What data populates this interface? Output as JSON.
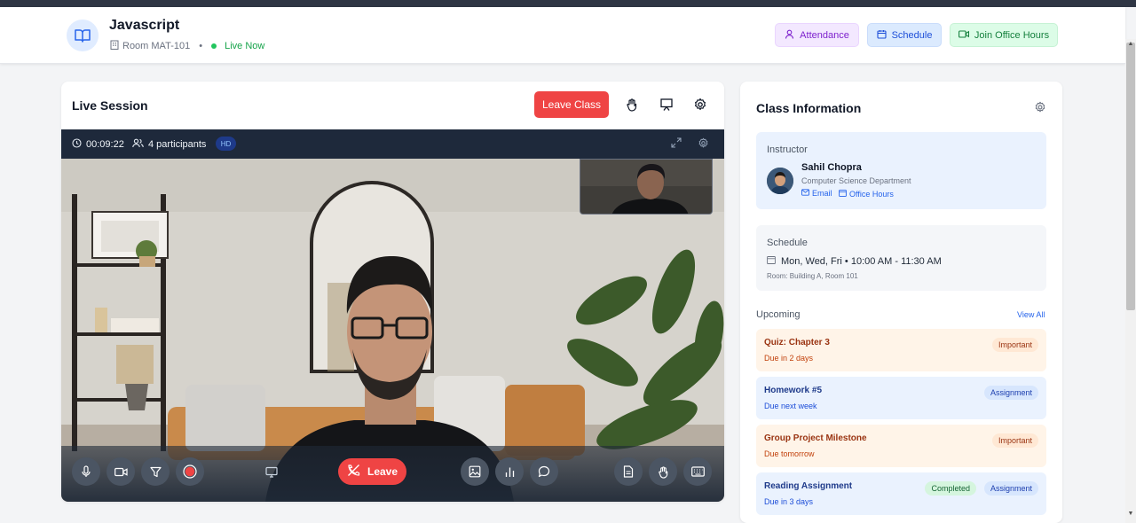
{
  "header": {
    "course_title": "Javascript",
    "room": "Room MAT-101",
    "separator": "•",
    "live_status": "Live Now",
    "buttons": {
      "attendance": "Attendance",
      "schedule": "Schedule",
      "office_hours": "Join Office Hours"
    }
  },
  "live_session": {
    "title": "Live Session",
    "leave_class_label": "Leave Class",
    "video": {
      "timer": "00:09:22",
      "participants": "4 participants",
      "quality_badge": "HD"
    },
    "controls": {
      "leave_label": "Leave"
    }
  },
  "class_info": {
    "title": "Class Information",
    "instructor": {
      "label": "Instructor",
      "name": "Sahil Chopra",
      "department": "Computer Science Department",
      "email_label": "Email",
      "office_hours_label": "Office Hours"
    },
    "schedule": {
      "label": "Schedule",
      "time": "Mon, Wed, Fri • 10:00 AM - 11:30 AM",
      "room": "Room: Building A, Room 101"
    },
    "upcoming": {
      "label": "Upcoming",
      "view_all": "View All",
      "items": [
        {
          "title": "Quiz: Chapter 3",
          "due": "Due in 2 days",
          "badge": "Important",
          "status": ""
        },
        {
          "title": "Homework #5",
          "due": "Due next week",
          "badge": "Assignment",
          "status": ""
        },
        {
          "title": "Group Project Milestone",
          "due": "Due tomorrow",
          "badge": "Important",
          "status": ""
        },
        {
          "title": "Reading Assignment",
          "due": "Due in 3 days",
          "badge": "Assignment",
          "status": "Completed"
        }
      ]
    }
  },
  "colors": {
    "accent_red": "#ef4444",
    "brand_blue": "#2563eb",
    "live_green": "#22c55e"
  }
}
